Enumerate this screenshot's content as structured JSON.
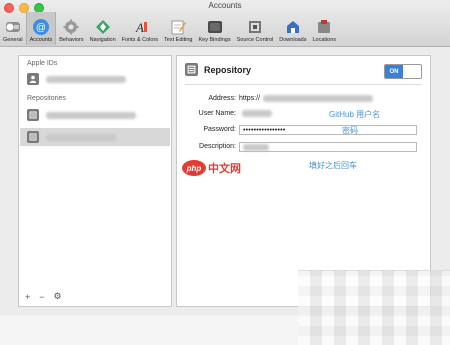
{
  "window": {
    "title": "Accounts"
  },
  "toolbar": {
    "items": [
      {
        "label": "General",
        "icon": "switch-icon"
      },
      {
        "label": "Accounts",
        "icon": "at-icon"
      },
      {
        "label": "Behaviors",
        "icon": "gear-icon"
      },
      {
        "label": "Navigation",
        "icon": "navigation-icon"
      },
      {
        "label": "Fonts & Colors",
        "icon": "font-icon"
      },
      {
        "label": "Text Editing",
        "icon": "pencil-icon"
      },
      {
        "label": "Key Bindings",
        "icon": "keyboard-icon"
      },
      {
        "label": "Source Control",
        "icon": "source-control-icon"
      },
      {
        "label": "Downloads",
        "icon": "downloads-icon"
      },
      {
        "label": "Locations",
        "icon": "locations-icon"
      }
    ],
    "active": "Accounts"
  },
  "sidebar": {
    "apple_ids_label": "Apple IDs",
    "repositories_label": "Repositories",
    "footer": {
      "add": "+",
      "remove": "−",
      "action": "⚙"
    }
  },
  "detail": {
    "title": "Repository",
    "toggle_label": "ON",
    "address_label": "Address:",
    "address_prefix": "https://",
    "username_label": "User Name:",
    "password_label": "Password:",
    "password_value": "••••••••••••••••",
    "description_label": "Description:"
  },
  "annotations": {
    "github_username": "GitHub 用户名",
    "password": "密码",
    "after_fill": "填好之后回车"
  },
  "watermark": {
    "php": "php",
    "site": "中文网"
  },
  "colors": {
    "accent": "#3b7fd8",
    "annotation": "#4a90d9",
    "watermark": "#e53c32"
  }
}
